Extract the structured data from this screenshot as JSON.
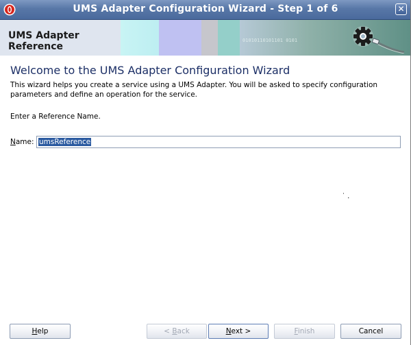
{
  "window": {
    "title": "UMS Adapter Configuration Wizard - Step 1 of 6",
    "close_glyph": "✕"
  },
  "banner": {
    "label": "UMS Adapter Reference",
    "icon": "gear-connector-icon",
    "binary_text": "01010110101101 0101"
  },
  "page": {
    "heading": "Welcome to the UMS Adapter Configuration Wizard",
    "description": "This wizard helps you create a service using a UMS Adapter. You will be asked to specify configuration parameters and define an operation for the service.",
    "prompt": "Enter a Reference Name."
  },
  "form": {
    "name_label_mnemonic": "N",
    "name_label_rest": "ame:",
    "name_value": "umsReference"
  },
  "artifact_text": "˙ .",
  "buttons": {
    "help": {
      "mnemonic": "H",
      "rest": "elp",
      "enabled": true
    },
    "back": {
      "prefix": "< ",
      "mnemonic": "B",
      "rest": "ack",
      "enabled": false
    },
    "next": {
      "mnemonic": "N",
      "rest": "ext >",
      "enabled": true
    },
    "finish": {
      "mnemonic": "F",
      "rest": "inish",
      "enabled": false
    },
    "cancel": {
      "label": "Cancel",
      "enabled": true
    }
  },
  "colors": {
    "titlebar": "#5877a7",
    "heading": "#1c2f66",
    "selection": "#2b5aa0"
  }
}
